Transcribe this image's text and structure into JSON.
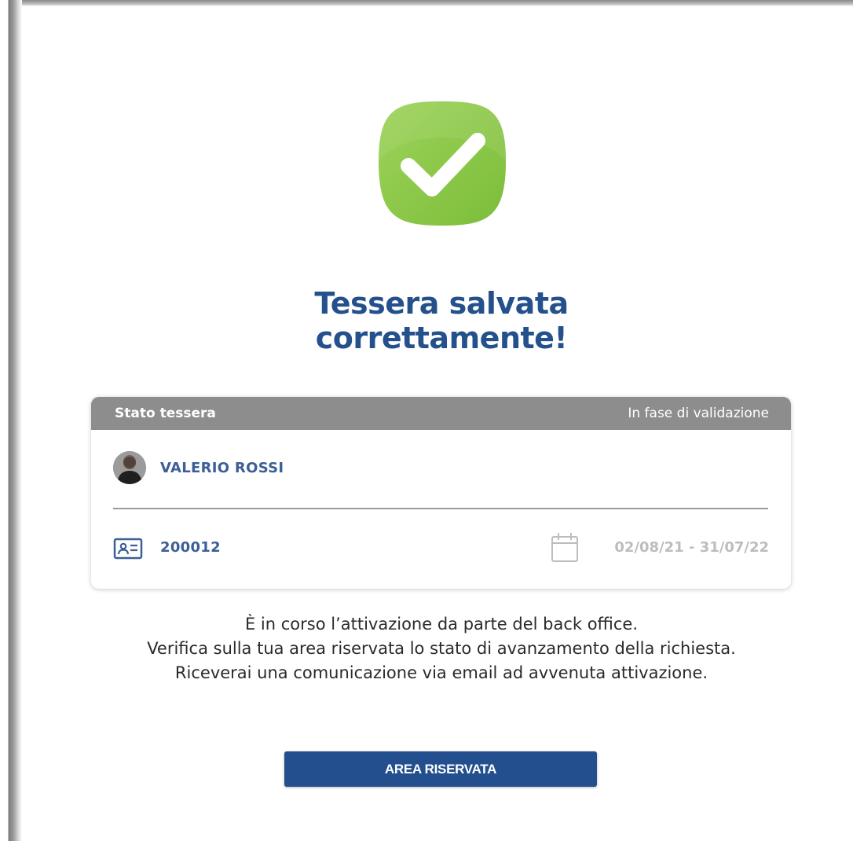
{
  "header": {
    "title_line1": "Tessera salvata",
    "title_line2": "correttamente!"
  },
  "card": {
    "status_label": "Stato tessera",
    "status_value": "In fase di validazione",
    "holder_name": "VALERIO ROSSI",
    "card_number": "200012",
    "validity_period": "02/08/21 - 31/07/22"
  },
  "message": {
    "line1": "È in corso l’attivazione da parte del back office.",
    "line2": "Verifica sulla tua area riservata lo stato di avanzamento della richiesta.",
    "line3": "Riceverai una comunicazione via email ad avvenuta attivazione."
  },
  "actions": {
    "reserved_area_label": "AREA RISERVATA"
  },
  "icons": {
    "success": "check-icon",
    "holder": "avatar",
    "card": "id-card-icon",
    "date": "calendar-icon"
  },
  "colors": {
    "title": "#24508c",
    "success_green": "#8cc63f",
    "header_grey": "#8d8d8d",
    "accent_blue": "#3b5f96",
    "button_blue": "#234f8e",
    "muted_text": "#bdbdbd"
  }
}
